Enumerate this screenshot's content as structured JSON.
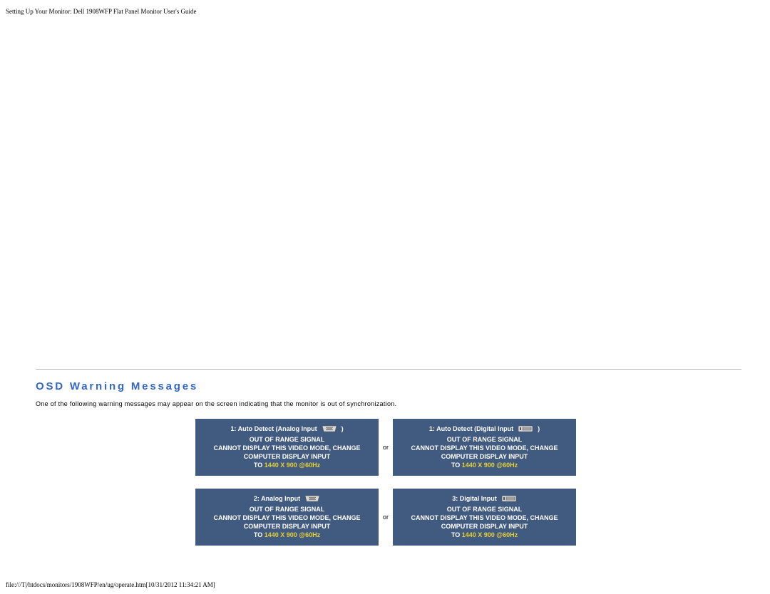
{
  "header": {
    "title": "Setting Up Your Monitor: Dell 1908WFP Flat Panel Monitor User's Guide"
  },
  "section": {
    "heading": "OSD Warning Messages",
    "intro": "One of the following warning messages may appear on the screen indicating that the monitor is out of synchronization."
  },
  "cards": {
    "or": "or",
    "a": {
      "input": "1: Auto Detect (Analog Input",
      "paren": ")",
      "l1": "OUT OF RANGE SIGNAL",
      "l2": "CANNOT DISPLAY THIS VIDEO MODE, CHANGE",
      "l3": "COMPUTER DISPLAY INPUT",
      "l4a": "TO ",
      "l4b": "1440 X 900 @60Hz"
    },
    "b": {
      "input": "1: Auto Detect (Digital Input",
      "paren": ")",
      "l1": "OUT OF RANGE SIGNAL",
      "l2": "CANNOT DISPLAY THIS VIDEO MODE, CHANGE",
      "l3": "COMPUTER DISPLAY INPUT",
      "l4a": "TO ",
      "l4b": "1440 X 900 @60Hz"
    },
    "c": {
      "input": "2: Analog Input",
      "l1": "OUT OF RANGE SIGNAL",
      "l2": "CANNOT DISPLAY THIS VIDEO MODE, CHANGE",
      "l3": "COMPUTER DISPLAY INPUT",
      "l4a": "TO ",
      "l4b": "1440 X 900 @60Hz"
    },
    "d": {
      "input": "3: Digital Input",
      "l1": "OUT OF RANGE SIGNAL",
      "l2": "CANNOT DISPLAY THIS VIDEO MODE, CHANGE",
      "l3": "COMPUTER DISPLAY INPUT",
      "l4a": "TO ",
      "l4b": "1440 X 900 @60Hz"
    }
  },
  "footer": {
    "text": "file:///T|/htdocs/monitors/1908WFP/en/ug/operate.htm[10/31/2012 11:34:21 AM]"
  }
}
